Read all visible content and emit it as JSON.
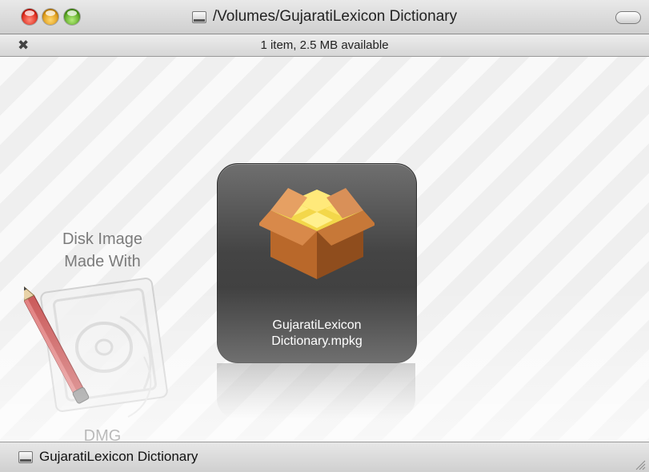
{
  "window": {
    "title": "/Volumes/GujaratiLexicon Dictionary",
    "title_icon": "disk-icon"
  },
  "status": {
    "text": "1 item, 2.5 MB available",
    "pin_icon": "pushpin-icon"
  },
  "background_badge": {
    "line1": "Disk Image",
    "line2": "Made With",
    "label": "DMG"
  },
  "files": [
    {
      "name_line1": "GujaratiLexicon",
      "name_line2": "Dictionary.mpkg",
      "icon": "package-icon"
    }
  ],
  "pathbar": {
    "item": "GujaratiLexicon Dictionary",
    "icon": "disk-icon"
  },
  "colors": {
    "traffic_red": "#d9190b",
    "traffic_yellow": "#d8900a",
    "traffic_green": "#4c9d14",
    "tile_bg": "#444444"
  }
}
